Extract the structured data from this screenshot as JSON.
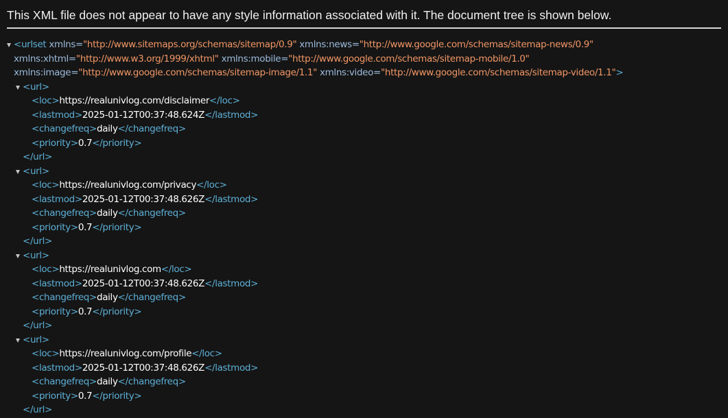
{
  "header": {
    "message": "This XML file does not appear to have any style information associated with it. The document tree is shown below."
  },
  "root": {
    "open": "<urlset",
    "close_bracket": ">",
    "attributes": [
      {
        "name": "xmlns",
        "value": "\"http://www.sitemaps.org/schemas/sitemap/0.9\""
      },
      {
        "name": "xmlns:news",
        "value": "\"http://www.google.com/schemas/sitemap-news/0.9\""
      },
      {
        "name": "xmlns:xhtml",
        "value": "\"http://www.w3.org/1999/xhtml\""
      },
      {
        "name": "xmlns:mobile",
        "value": "\"http://www.google.com/schemas/sitemap-mobile/1.0\""
      },
      {
        "name": "xmlns:image",
        "value": "\"http://www.google.com/schemas/sitemap-image/1.1\""
      },
      {
        "name": "xmlns:video",
        "value": "\"http://www.google.com/schemas/sitemap-video/1.1\""
      }
    ]
  },
  "tags": {
    "url_open": "<url>",
    "url_close": "</url>",
    "loc_open": "<loc>",
    "loc_close": "</loc>",
    "lastmod_open": "<lastmod>",
    "lastmod_close": "</lastmod>",
    "changefreq_open": "<changefreq>",
    "changefreq_close": "</changefreq>",
    "priority_open": "<priority>",
    "priority_close": "</priority>"
  },
  "urls": [
    {
      "loc": "https://realunivlog.com/disclaimer",
      "lastmod": "2025-01-12T00:37:48.624Z",
      "changefreq": "daily",
      "priority": "0.7"
    },
    {
      "loc": "https://realunivlog.com/privacy",
      "lastmod": "2025-01-12T00:37:48.626Z",
      "changefreq": "daily",
      "priority": "0.7"
    },
    {
      "loc": "https://realunivlog.com",
      "lastmod": "2025-01-12T00:37:48.626Z",
      "changefreq": "daily",
      "priority": "0.7"
    },
    {
      "loc": "https://realunivlog.com/profile",
      "lastmod": "2025-01-12T00:37:48.626Z",
      "changefreq": "daily",
      "priority": "0.7"
    }
  ],
  "colors": {
    "background": "#151515",
    "tag": "#5db0d7",
    "attribute_name": "#9bbbdc",
    "attribute_value": "#f29766",
    "text": "#ffffff",
    "toggle_icon": "#c8c8c8"
  }
}
